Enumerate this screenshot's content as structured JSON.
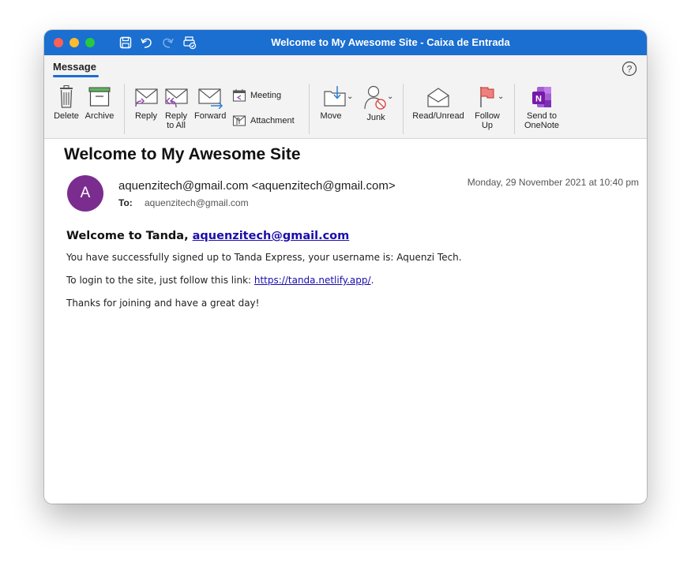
{
  "window": {
    "title": "Welcome to My Awesome Site - Caixa de Entrada"
  },
  "ribbon": {
    "tab_label": "Message",
    "buttons": {
      "delete": "Delete",
      "archive": "Archive",
      "reply": "Reply",
      "reply_all_line1": "Reply",
      "reply_all_line2": "to All",
      "forward": "Forward",
      "meeting": "Meeting",
      "attachment": "Attachment",
      "move": "Move",
      "junk": "Junk",
      "read_unread": "Read/Unread",
      "follow_up_line1": "Follow",
      "follow_up_line2": "Up",
      "onenote_line1": "Send to",
      "onenote_line2": "OneNote"
    }
  },
  "message": {
    "subject": "Welcome to My Awesome Site",
    "avatar_initial": "A",
    "sender": "aquenzitech@gmail.com <aquenzitech@gmail.com>",
    "date": "Monday, 29 November 2021 at 10:40 pm",
    "to_label": "To:",
    "to_value": "aquenzitech@gmail.com",
    "body": {
      "greeting_prefix": "Welcome to Tanda, ",
      "greeting_link": "aquenzitech@gmail.com",
      "line1": "You have successfully signed up to Tanda Express, your username is: Aquenzi Tech.",
      "line2_prefix": "To login to the site, just follow this link: ",
      "line2_link": "https://tanda.netlify.app/",
      "line2_suffix": ".",
      "line3": "Thanks for joining and have a great day!"
    }
  },
  "colors": {
    "titlebar": "#1a6fd0",
    "avatar": "#7b2d8f",
    "link": "#1a0dab"
  }
}
